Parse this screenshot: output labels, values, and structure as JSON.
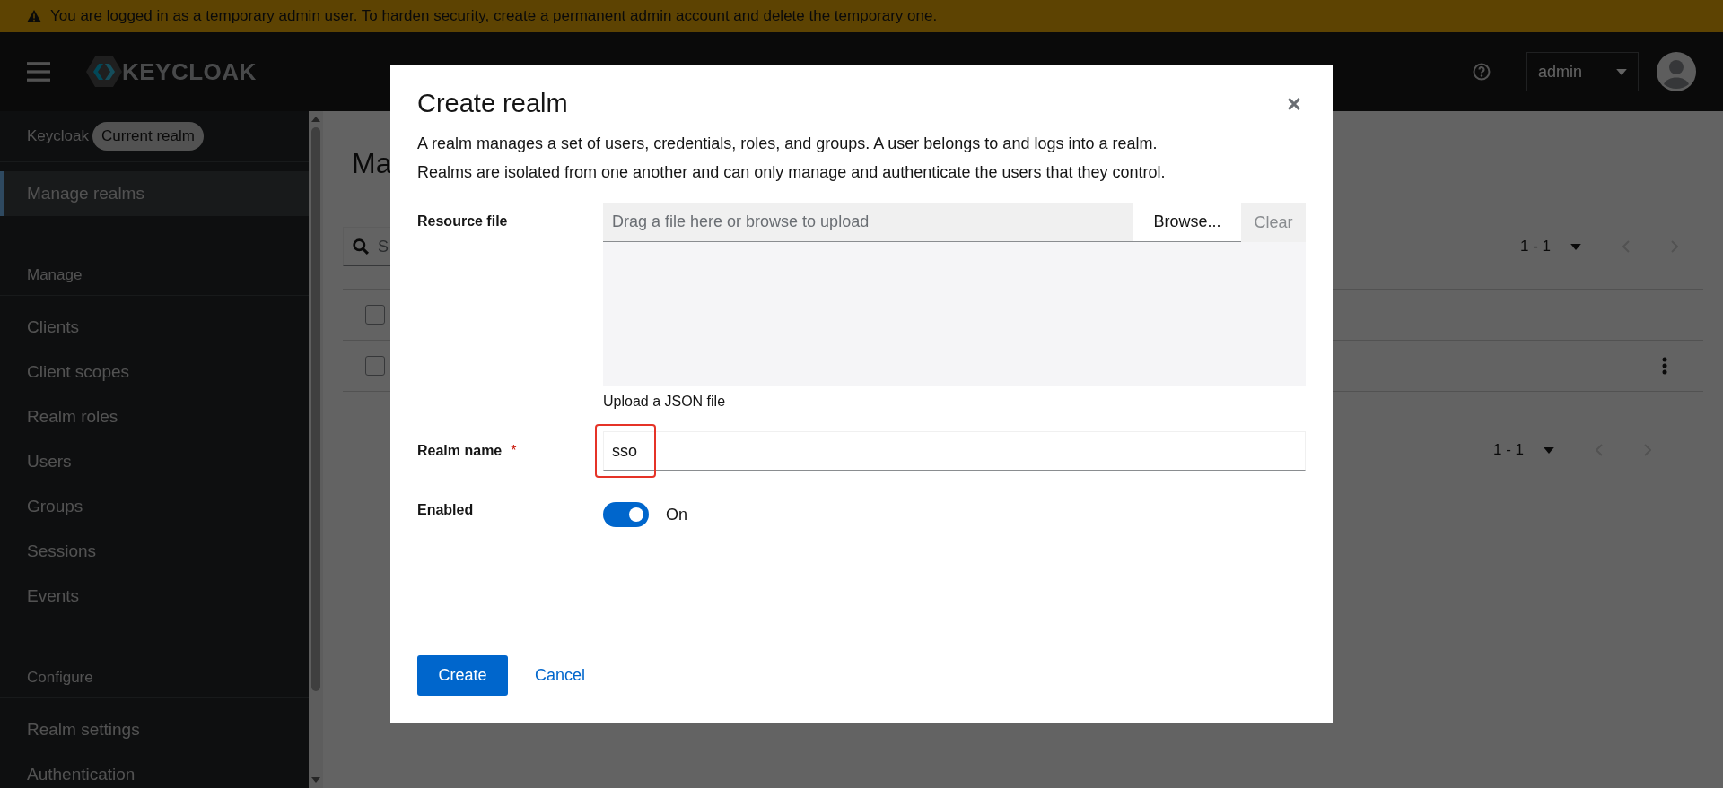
{
  "banner": {
    "text": "You are logged in as a temporary admin user. To harden security, create a permanent admin account and delete the temporary one."
  },
  "header": {
    "logo": "KEYCLOAK",
    "user": "admin"
  },
  "sidebar": {
    "realm": "Keycloak",
    "realm_badge": "Current realm",
    "top_items": [
      {
        "label": "Manage realms",
        "selected": true
      }
    ],
    "sections": [
      {
        "heading": "Manage",
        "items": [
          {
            "label": "Clients",
            "selected": false
          },
          {
            "label": "Client scopes",
            "selected": false
          },
          {
            "label": "Realm roles",
            "selected": false
          },
          {
            "label": "Users",
            "selected": false
          },
          {
            "label": "Groups",
            "selected": false
          },
          {
            "label": "Sessions",
            "selected": false
          },
          {
            "label": "Events",
            "selected": false
          }
        ]
      },
      {
        "heading": "Configure",
        "items": [
          {
            "label": "Realm settings",
            "selected": false
          },
          {
            "label": "Authentication",
            "selected": false
          }
        ]
      }
    ]
  },
  "page": {
    "title": "Ma",
    "search_placeholder": "S",
    "pagination_top": "1 - 1",
    "pagination_bottom": "1 - 1",
    "checkboxes": [
      {
        "checked": false
      },
      {
        "checked": false
      }
    ]
  },
  "dialog": {
    "title": "Create realm",
    "description": "A realm manages a set of users, credentials, roles, and groups. A user belongs to and logs into a realm. Realms are isolated from one another and can only manage and authenticate the users that they control.",
    "fields": [
      {
        "kind": "file",
        "label": "Resource file",
        "placeholder": "Drag a file here or browse to upload",
        "browse": "Browse...",
        "clear": "Clear",
        "helper": "Upload a JSON file"
      },
      {
        "kind": "text",
        "label": "Realm name",
        "required": true,
        "required_mark": "*",
        "value": "sso"
      },
      {
        "kind": "switch",
        "label": "Enabled",
        "on": true,
        "state_label": "On"
      }
    ],
    "buttons": [
      {
        "kind": "primary",
        "label": "Create"
      },
      {
        "kind": "link",
        "label": "Cancel"
      }
    ]
  }
}
